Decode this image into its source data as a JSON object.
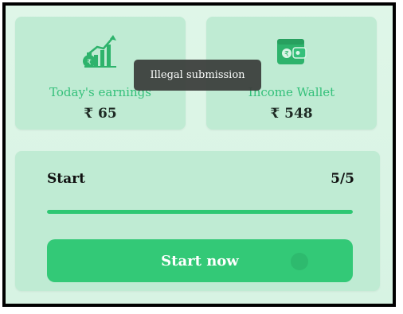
{
  "earnings_card": {
    "label": "Today's earnings",
    "value": "₹ 65",
    "icon": "money-growth-icon"
  },
  "wallet_card": {
    "label": "Income Wallet",
    "value": "₹ 548",
    "icon": "wallet-icon"
  },
  "toast": {
    "message": "Illegal submission"
  },
  "task": {
    "title": "Start",
    "count": "5/5",
    "progress": 1.0,
    "button_label": "Start now"
  },
  "colors": {
    "accent": "#33c977",
    "card_bg": "#bfebd3",
    "label_green": "#34c07a",
    "toast_bg": "#3c3f3d"
  }
}
